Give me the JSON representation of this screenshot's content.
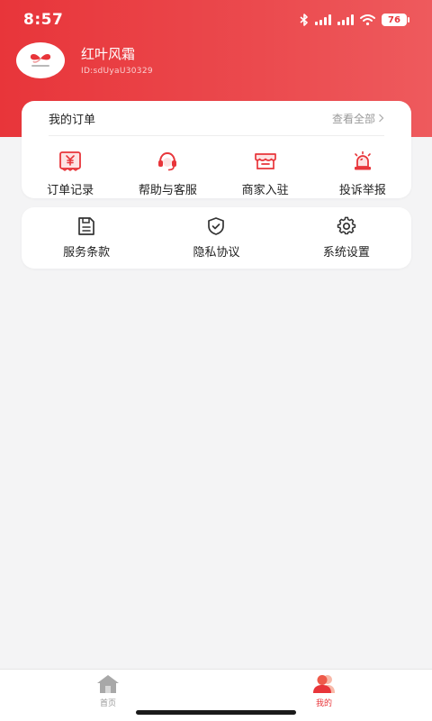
{
  "statusbar": {
    "time": "8:57",
    "battery": "76"
  },
  "profile": {
    "username": "红叶风霜",
    "user_id": "ID:sdUyaU30329",
    "avatar_text": "红叶风霜"
  },
  "orders": {
    "title": "我的订单",
    "view_all": "查看全部",
    "items": [
      {
        "label": "订单记录",
        "icon": "receipt-yen-icon"
      },
      {
        "label": "帮助与客服",
        "icon": "headset-icon"
      },
      {
        "label": "商家入驻",
        "icon": "storefront-icon"
      },
      {
        "label": "投诉举报",
        "icon": "alarm-light-icon"
      }
    ]
  },
  "links": {
    "items": [
      {
        "label": "服务条款",
        "icon": "document-icon"
      },
      {
        "label": "隐私协议",
        "icon": "shield-check-icon"
      },
      {
        "label": "系统设置",
        "icon": "gear-icon"
      }
    ]
  },
  "tabbar": {
    "tabs": [
      {
        "label": "首页",
        "icon": "home-icon",
        "active": false
      },
      {
        "label": "我的",
        "icon": "user-icon",
        "active": true
      }
    ]
  },
  "colors": {
    "brand_red": "#e8353a",
    "text_gray": "#999999",
    "background": "#f4f4f5"
  }
}
